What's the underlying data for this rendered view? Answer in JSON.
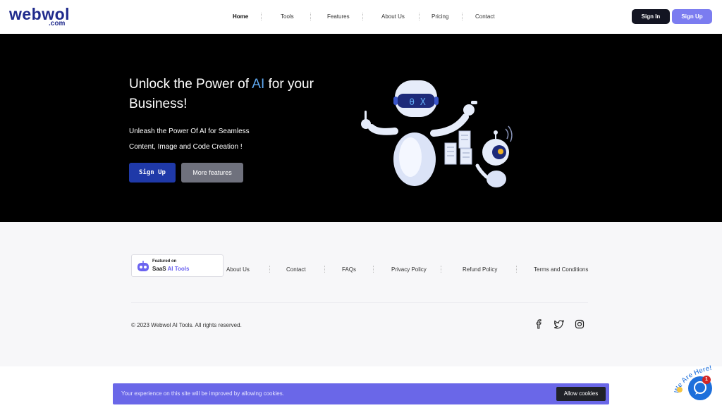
{
  "header": {
    "logo": {
      "main": "webwol",
      "sub": ".com"
    },
    "nav": [
      "Home",
      "Tools",
      "Features",
      "About Us",
      "Pricing",
      "Contact"
    ],
    "sign_in": "Sign In",
    "sign_up": "Sign Up"
  },
  "hero": {
    "title_before": "Unlock the Power of ",
    "title_accent": "AI",
    "title_after": " for your Business!",
    "subtitle_line1": "Unleash the Power Of AI for Seamless",
    "subtitle_line2": "Content, Image and Code Creation !",
    "btn_primary": "Sign Up",
    "btn_secondary": "More features"
  },
  "footer": {
    "badge": {
      "small": "Featured on",
      "big_plain": "SaaS ",
      "big_accent": "AI Tools"
    },
    "links": [
      "About Us",
      "Contact",
      "FAQs",
      "Privacy Policy",
      "Refund Policy",
      "Terms and Conditions"
    ],
    "copyright": "© 2023 Webwol AI Tools. All rights reserved.",
    "social_icons": [
      "facebook-icon",
      "twitter-icon",
      "instagram-icon"
    ]
  },
  "cookie": {
    "text": "Your experience on this site will be improved by allowing cookies.",
    "button": "Allow cookies"
  },
  "chat": {
    "banner": "We Are Here!",
    "unread": "1"
  },
  "colors": {
    "brand": "#1f2a8c",
    "accent": "#7b7cf0",
    "hero_bg": "#000000",
    "hero_ai": "#5fa9f2",
    "primary_btn": "#1f39a8",
    "cookie_bg": "#6a67e8"
  }
}
